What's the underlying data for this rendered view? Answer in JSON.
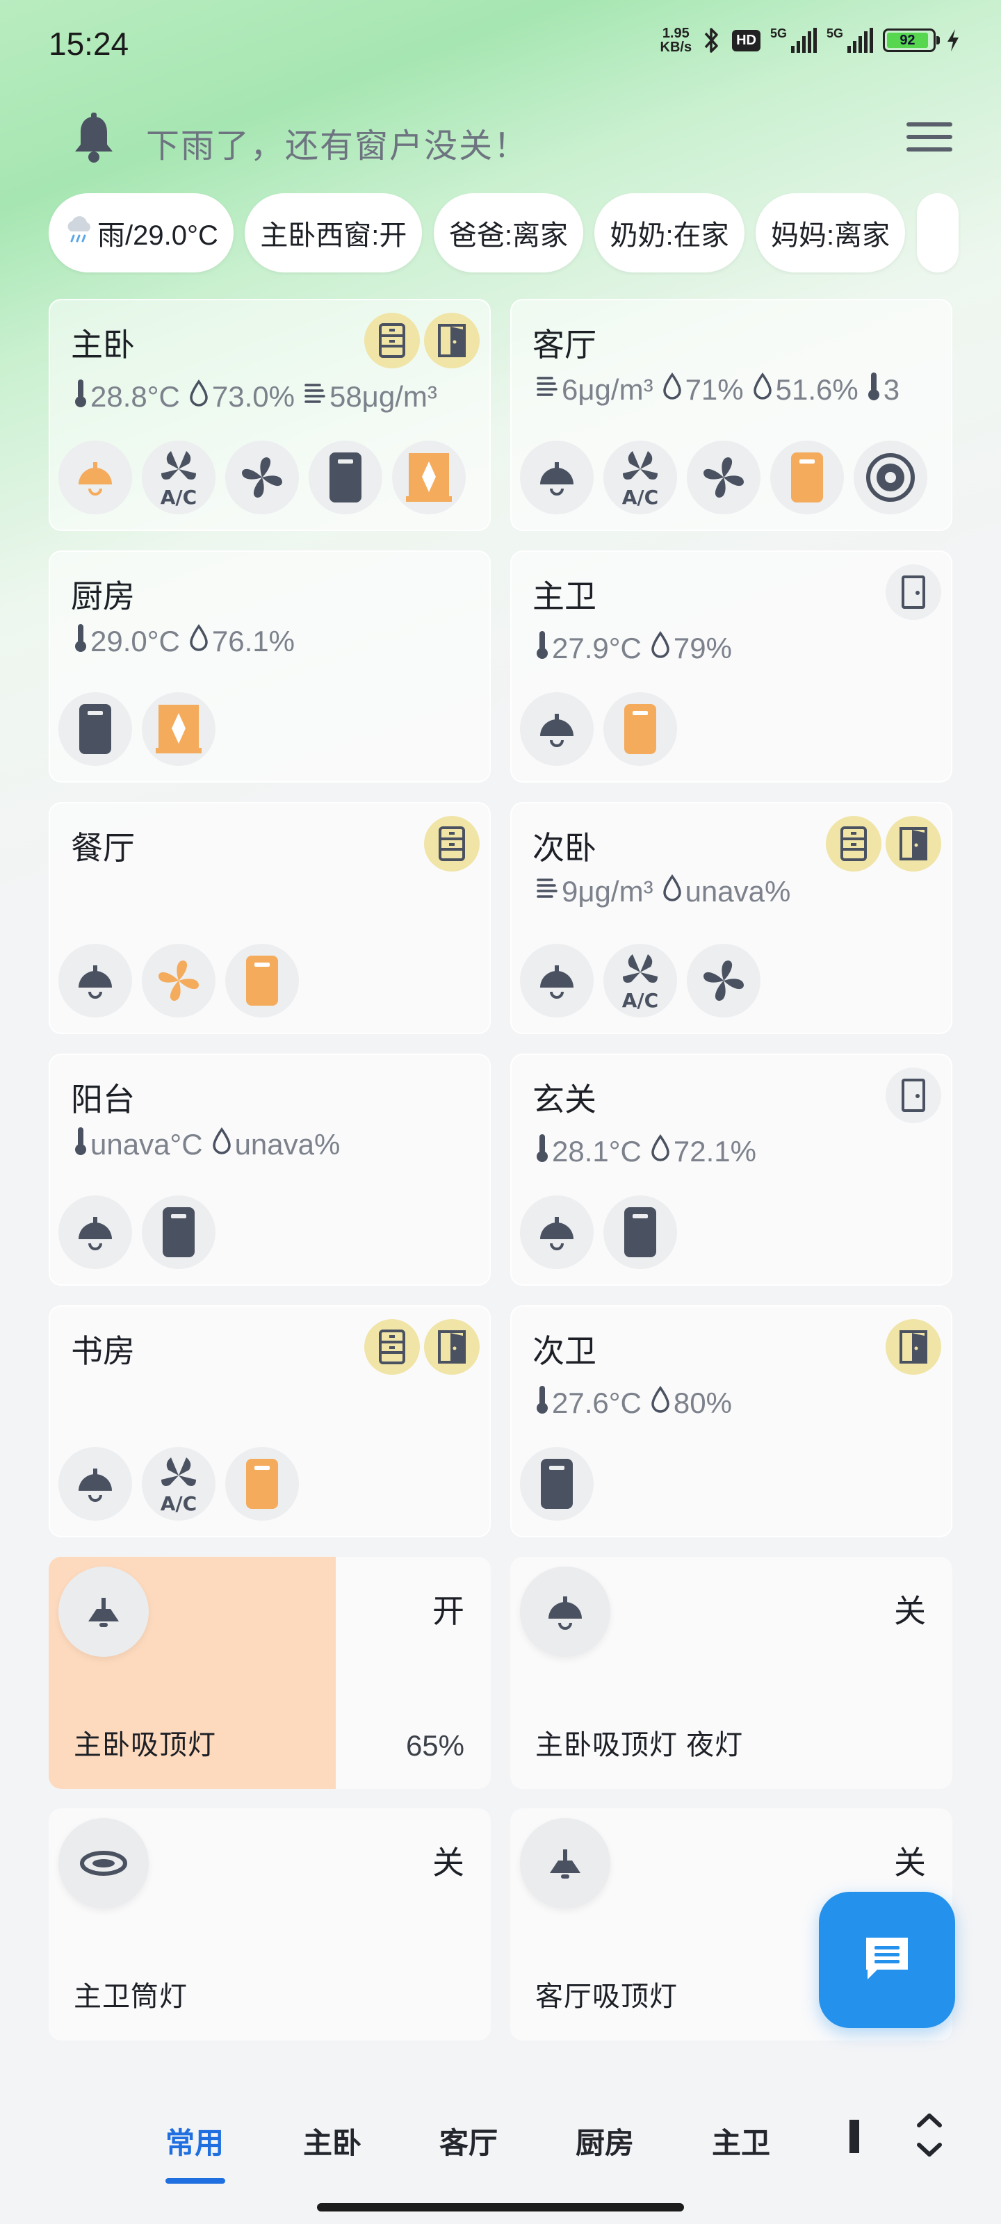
{
  "status": {
    "time": "15:24",
    "net_speed_value": "1.95",
    "net_speed_unit": "KB/s",
    "hd_label": "HD",
    "net1": "5G",
    "net2": "5G",
    "battery": "92"
  },
  "header": {
    "alert": "下雨了，还有窗户没关！"
  },
  "chips": [
    {
      "label": "雨/29.0°C",
      "icon": "rain-cloud-icon"
    },
    {
      "label": "主卧西窗:开"
    },
    {
      "label": "爸爸:离家"
    },
    {
      "label": "奶奶:在家"
    },
    {
      "label": "妈妈:离家"
    }
  ],
  "rooms": [
    {
      "name": "主卧",
      "sensors": [
        "28.8°C",
        "73.0%",
        "58μg/m³"
      ]
    },
    {
      "name": "客厅",
      "sensors": [
        "6μg/m³",
        "71%",
        "51.6%",
        "3"
      ]
    },
    {
      "name": "厨房",
      "sensors": [
        "29.0°C",
        "76.1%"
      ]
    },
    {
      "name": "主卫",
      "sensors": [
        "27.9°C",
        "79%"
      ]
    },
    {
      "name": "餐厅",
      "sensors": []
    },
    {
      "name": "次卧",
      "sensors": [
        "9μg/m³",
        "unava%"
      ]
    },
    {
      "name": "阳台",
      "sensors": [
        "unava°C",
        "unava%"
      ]
    },
    {
      "name": "玄关",
      "sensors": [
        "28.1°C",
        "72.1%"
      ]
    },
    {
      "name": "书房",
      "sensors": []
    },
    {
      "name": "次卫",
      "sensors": [
        "27.6°C",
        "80%"
      ]
    }
  ],
  "lights": [
    {
      "name": "主卧吸顶灯",
      "state": "开",
      "brightness_label": "65%",
      "brightness": 0.65
    },
    {
      "name": "主卧吸顶灯 夜灯",
      "state": "关"
    },
    {
      "name": "主卫筒灯",
      "state": "关"
    },
    {
      "name": "客厅吸顶灯",
      "state": "关"
    }
  ],
  "tabs": [
    "常用",
    "主卧",
    "客厅",
    "厨房",
    "主卫"
  ],
  "colors": {
    "accent": "#1f6fe0",
    "fab": "#2491ec",
    "device_on": "#f4ab5c",
    "device_off": "#4a5160",
    "badge_active": "#f0e4a6",
    "brightness_fill": "#fdd9bd"
  }
}
